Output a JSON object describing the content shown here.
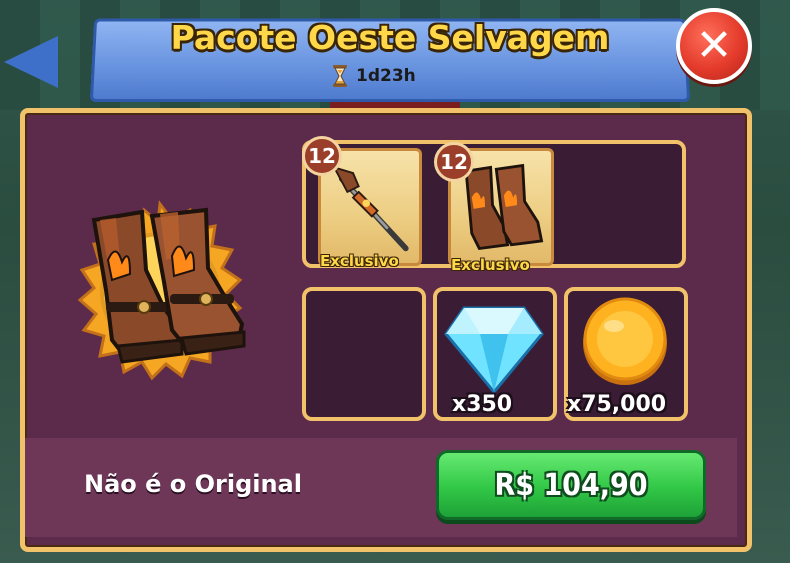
{
  "header": {
    "title": "Pacote Oeste Selvagem",
    "timer": "1d23h"
  },
  "items": {
    "rifle": {
      "level": "12",
      "tag": "Exclusivo"
    },
    "boots": {
      "level": "12",
      "tag": "Exclusivo"
    },
    "gems": {
      "quantity": "x350"
    },
    "coins": {
      "quantity": "x75,000"
    }
  },
  "footer": {
    "label": "Não é o Original",
    "price": "R$ 104,90"
  },
  "colors": {
    "ribbon": "#6a95e0",
    "panel": "#5c2a4a",
    "gold_border": "#f2c26a",
    "buy_green": "#31c746",
    "close_red": "#e43b2c"
  }
}
